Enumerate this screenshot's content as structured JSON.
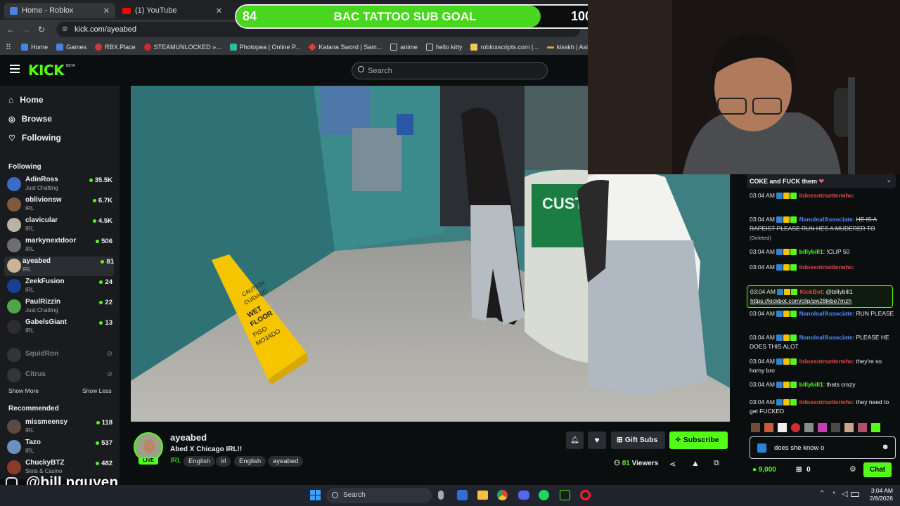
{
  "browser": {
    "tabs": [
      {
        "title": "Home - Roblox"
      },
      {
        "title": "(1) YouTube"
      }
    ],
    "url": "kick.com/ayeabed",
    "bookmarks": [
      "Home",
      "Games",
      "RBX.Place",
      "STEAMUNLOCKED »...",
      "Photopea | Online P...",
      "Katana Sword | Sam...",
      "anime",
      "hello kitty",
      "robloxscripts.com |...",
      "kisskh | Asian Dram..."
    ]
  },
  "overlay": {
    "goal_label": "BAC TATTOO SUB GOAL",
    "current": "84",
    "target": "100",
    "progress": 0.84,
    "watermark": "@bill.nguyen"
  },
  "header": {
    "logo": "KICK",
    "logo_beta": "BETA",
    "search_placeholder": "Search"
  },
  "sidebar": {
    "nav": [
      {
        "label": "Home",
        "icon": "home-icon"
      },
      {
        "label": "Browse",
        "icon": "compass-icon"
      },
      {
        "label": "Following",
        "icon": "heart-icon"
      }
    ],
    "following_title": "Following",
    "following": [
      {
        "name": "AdinRoss",
        "category": "Just Chatting",
        "viewers": "35.5K",
        "color": "#3a6bc7"
      },
      {
        "name": "oblivionsw",
        "category": "IRL",
        "viewers": "6.7K",
        "color": "#7d5a3c"
      },
      {
        "name": "clavicular",
        "category": "IRL",
        "viewers": "4.5K",
        "color": "#b9b2a6"
      },
      {
        "name": "markynextdoor",
        "category": "IRL",
        "viewers": "506",
        "color": "#6f6f6f"
      },
      {
        "name": "ayeabed",
        "category": "IRL",
        "viewers": "81",
        "color": "#c9b49a"
      },
      {
        "name": "ZeekFusion",
        "category": "IRL",
        "viewers": "24",
        "color": "#1c3f94"
      },
      {
        "name": "PaulRizzin",
        "category": "Just Chatting",
        "viewers": "22",
        "color": "#4fa648"
      },
      {
        "name": "GabelsGiant",
        "category": "IRL",
        "viewers": "13",
        "color": "#2d2d2d"
      }
    ],
    "offline": [
      {
        "name": "SquidRon"
      },
      {
        "name": "Citrus"
      }
    ],
    "show_more": "Show More",
    "show_less": "Show Less",
    "recommended_title": "Recommended",
    "recommended": [
      {
        "name": "missmeensy",
        "category": "IRL",
        "viewers": "118",
        "color": "#5b4b44"
      },
      {
        "name": "Tazo",
        "category": "IRL",
        "viewers": "537",
        "color": "#6c8fbf"
      },
      {
        "name": "ChuckyBTZ",
        "category": "Slots & Casino",
        "viewers": "482",
        "color": "#8c3b2a"
      }
    ]
  },
  "stream": {
    "channel": "ayeabed",
    "title": "Abed X Chicago IRL!!",
    "live_badge": "LIVE",
    "category": "IRL",
    "tags": [
      "English",
      "irl",
      "English",
      "ayeabed"
    ],
    "gift_subs": "Gift Subs",
    "subscribe": "Subscribe",
    "viewers": "81",
    "viewers_label": "Viewers",
    "wet_floor_sign": [
      "CAUTION",
      "CUIDADO",
      "WET",
      "FLOOR",
      "PISO",
      "MOJADO"
    ],
    "counter_sign": "CUSTO SERVIC"
  },
  "chat": {
    "pinned_partial": "COKE and FUCK them",
    "messages": [
      {
        "time": "03:04 AM",
        "user": "itdoesntmatterwho",
        "user_color": "#e4474a",
        "text": ""
      },
      {
        "time": "03:04 AM",
        "user": "NanoleafAssociate",
        "user_color": "#4f8cff",
        "text": "HE IS A RAPEIST PLEASE RUN HES A MUDERER TO",
        "deleted": "(Deleted)"
      },
      {
        "time": "03:04 AM",
        "user": "billybill1",
        "user_color": "#53fc18",
        "text": "!CLIP 50"
      },
      {
        "time": "03:04 AM",
        "user": "itdoesntmatterwho",
        "user_color": "#e4474a",
        "text": ""
      },
      {
        "time": "03:04 AM",
        "user": "KickBot",
        "user_color": "#e4474a",
        "text": "@billybill1",
        "link": "https://kickbot.com/clip/sw28ikbe7mzh"
      },
      {
        "time": "03:04 AM",
        "user": "NanoleafAssociate",
        "user_color": "#4f8cff",
        "text": "RUN PLEASE"
      },
      {
        "time": "03:04 AM",
        "user": "NanoleafAssociate",
        "user_color": "#4f8cff",
        "text": "PLEASE HE DOES THIS ALOT"
      },
      {
        "time": "03:04 AM",
        "user": "itdoesntmatterwho",
        "user_color": "#e4474a",
        "text": "they're so horny bro"
      },
      {
        "time": "03:04 AM",
        "user": "billybill1",
        "user_color": "#53fc18",
        "text": "thats crazy"
      },
      {
        "time": "03:04 AM",
        "user": "itdoesntmatterwho",
        "user_color": "#e4474a",
        "text": "they need to get FUCKED"
      }
    ],
    "input_value": "does she know o",
    "points": "9,000",
    "kicks": "0",
    "send": "Chat"
  },
  "taskbar": {
    "search_placeholder": "Search",
    "time": "3:04 AM",
    "date": "2/8/2026"
  }
}
